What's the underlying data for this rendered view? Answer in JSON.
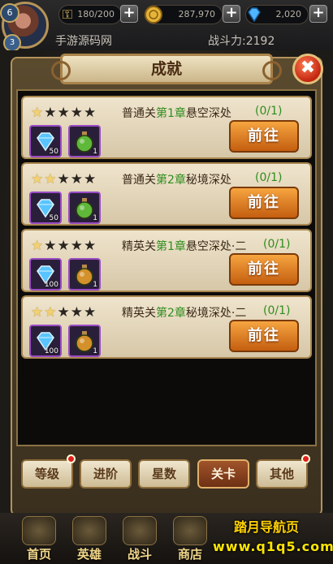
{
  "header": {
    "avatar_level": "6",
    "avatar_badge": "3",
    "keys": "180/200",
    "gold": "287,970",
    "diamonds": "2,020",
    "server_name": "手游源码网",
    "power_label": "战斗力:2192"
  },
  "panel": {
    "title": "成就",
    "close_label": "✖"
  },
  "rows": [
    {
      "stars_lit": 1,
      "stars_total": 5,
      "prefix": "普通关",
      "chapter": "第1章",
      "suffix": "悬空深处",
      "progress": "(0/1)",
      "gem_count": "50",
      "item2_count": "1",
      "item2": "green-potion",
      "button": "前往"
    },
    {
      "stars_lit": 2,
      "stars_total": 5,
      "prefix": "普通关",
      "chapter": "第2章",
      "suffix": "秘境深处",
      "progress": "(0/1)",
      "gem_count": "50",
      "item2_count": "1",
      "item2": "green-potion",
      "button": "前往"
    },
    {
      "stars_lit": 1,
      "stars_total": 5,
      "prefix": "精英关",
      "chapter": "第1章",
      "suffix": "悬空深处·二",
      "progress": "(0/1)",
      "gem_count": "100",
      "item2_count": "1",
      "item2": "orange-potion",
      "button": "前往"
    },
    {
      "stars_lit": 2,
      "stars_total": 5,
      "prefix": "精英关",
      "chapter": "第2章",
      "suffix": "秘境深处·二",
      "progress": "(0/1)",
      "gem_count": "100",
      "item2_count": "1",
      "item2": "orange-potion",
      "button": "前往"
    }
  ],
  "tabs": [
    {
      "label": "等级",
      "dot": true,
      "active": false
    },
    {
      "label": "进阶",
      "dot": false,
      "active": false
    },
    {
      "label": "星数",
      "dot": false,
      "active": false
    },
    {
      "label": "关卡",
      "dot": false,
      "active": true
    },
    {
      "label": "其他",
      "dot": true,
      "active": false
    }
  ],
  "nav": [
    "首页",
    "英雄",
    "战斗",
    "商店"
  ],
  "watermark": {
    "line1": "踏月导航页",
    "line2": "www.q1q5.com"
  },
  "colors": {
    "highlight_green": "#2f8d1e",
    "button_orange": "#e48a2a",
    "close_red": "#c2260f"
  }
}
